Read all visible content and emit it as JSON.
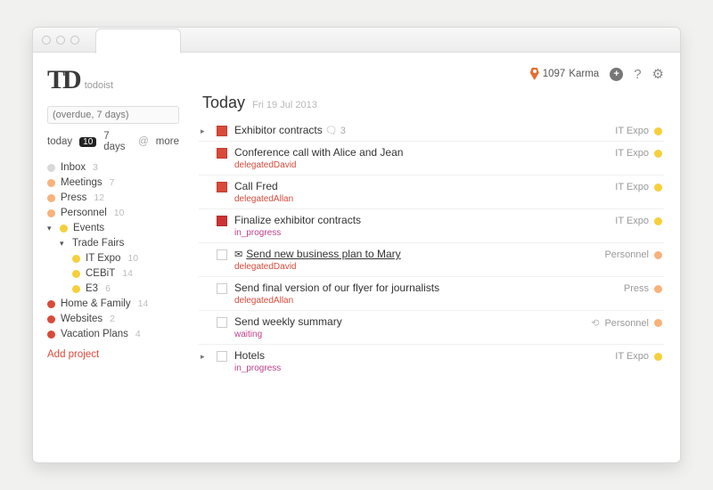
{
  "app": {
    "name": "todoist"
  },
  "search": {
    "value": "(overdue, 7 days)"
  },
  "filters": {
    "today_label": "today",
    "today_count": "10",
    "sevendays_label": "7 days",
    "more_label": "more"
  },
  "sidebar": {
    "inbox": {
      "label": "Inbox",
      "count": "3"
    },
    "projects": [
      {
        "label": "Meetings",
        "count": "7",
        "color": "c-peach"
      },
      {
        "label": "Press",
        "count": "12",
        "color": "c-peach"
      },
      {
        "label": "Personnel",
        "count": "10",
        "color": "c-peach"
      },
      {
        "label": "Events",
        "count": "",
        "color": "c-yellow",
        "expanded": true,
        "children": [
          {
            "label": "Trade Fairs",
            "count": "",
            "color": "",
            "expanded": true,
            "children": [
              {
                "label": "IT Expo",
                "count": "10",
                "color": "c-yellow"
              },
              {
                "label": "CEBiT",
                "count": "14",
                "color": "c-yellow"
              },
              {
                "label": "E3",
                "count": "6",
                "color": "c-yellow"
              }
            ]
          }
        ]
      },
      {
        "label": "Home & Family",
        "count": "14",
        "color": "c-red"
      },
      {
        "label": "Websites",
        "count": "2",
        "color": "c-red"
      },
      {
        "label": "Vacation Plans",
        "count": "4",
        "color": "c-red"
      }
    ],
    "add_project": "Add project"
  },
  "karma": {
    "value": "1097",
    "label": "Karma"
  },
  "heading": {
    "title": "Today",
    "date": "Fri 19 Jul 2013"
  },
  "tasks": [
    {
      "expand": true,
      "priority": "red",
      "title": "Exhibitor contracts",
      "comments": "3",
      "project": "IT Expo",
      "pcolor": "c-yellow"
    },
    {
      "priority": "red",
      "title": "Conference call with Alice and Jean",
      "sublabel": "delegatedDavid",
      "subcolor": "lbl-red",
      "project": "IT Expo",
      "pcolor": "c-yellow"
    },
    {
      "priority": "red",
      "title": "Call Fred",
      "sublabel": "delegatedAllan",
      "subcolor": "lbl-red",
      "project": "IT Expo",
      "pcolor": "c-yellow"
    },
    {
      "priority": "red2",
      "title": "Finalize exhibitor contracts",
      "sublabel": "in_progress",
      "subcolor": "lbl-magenta",
      "project": "IT Expo",
      "pcolor": "c-yellow"
    },
    {
      "priority": "none",
      "email": true,
      "title": "Send new business plan to Mary",
      "underline": true,
      "sublabel": "delegatedDavid",
      "subcolor": "lbl-red",
      "project": "Personnel",
      "pcolor": "c-peach"
    },
    {
      "priority": "none",
      "title": "Send final version of our flyer for journalists",
      "sublabel": "delegatedAllan",
      "subcolor": "lbl-red",
      "project": "Press",
      "pcolor": "c-peach"
    },
    {
      "priority": "none",
      "title": "Send weekly summary",
      "sublabel": "waiting",
      "subcolor": "lbl-magenta",
      "refresh": true,
      "project": "Personnel",
      "pcolor": "c-peach"
    },
    {
      "expand": true,
      "priority": "none",
      "title": "Hotels",
      "sublabel": "in_progress",
      "subcolor": "lbl-magenta",
      "project": "IT Expo",
      "pcolor": "c-yellow"
    }
  ]
}
